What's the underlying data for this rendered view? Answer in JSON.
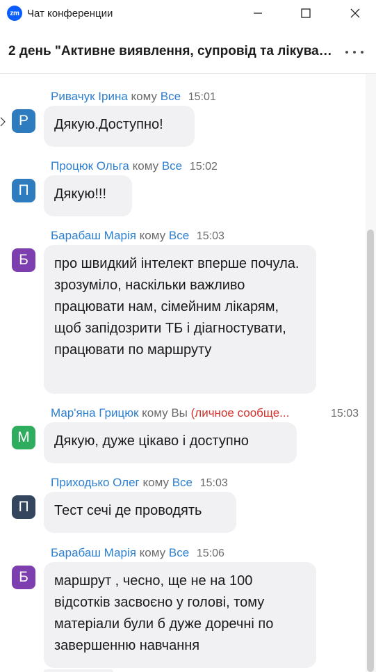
{
  "window": {
    "logo_text": "zm",
    "title": "Чат конференции"
  },
  "header": {
    "title": "2 день \"Активне виявлення, супровід та лікування"
  },
  "messages": [
    {
      "avatar_letter": "Р",
      "avatar_color": "#2e7cc0",
      "sender": "Ривачук Ірина",
      "to_word": "кому",
      "to_target": "Все",
      "private": "",
      "time": "15:01",
      "text": "Дякую.Доступно!"
    },
    {
      "avatar_letter": "П",
      "avatar_color": "#2e7cc0",
      "sender": "Процюк Ольга",
      "to_word": "кому",
      "to_target": "Все",
      "private": "",
      "time": "15:02",
      "text": "Дякую!!!"
    },
    {
      "avatar_letter": "Б",
      "avatar_color": "#7d3fb0",
      "sender": "Барабаш Марія",
      "to_word": "кому",
      "to_target": "Все",
      "private": "",
      "time": "15:03",
      "text": "про швидкий  інтелект вперше почула. зрозуміло, наскільки важливо працювати нам, сімейним лікарям, щоб запідозрити ТБ і діагностувати, працювати по маршруту"
    },
    {
      "avatar_letter": "М",
      "avatar_color": "#2ead5e",
      "sender": "Мар'яна Грицюк",
      "to_word": "кому Вы",
      "to_target": "",
      "private": "(личное сообще...",
      "time": "15:03",
      "text": "Дякую,  дуже цікаво і доступно"
    },
    {
      "avatar_letter": "П",
      "avatar_color": "#33465e",
      "sender": "Приходько Олег",
      "to_word": "кому",
      "to_target": "Все",
      "private": "",
      "time": "15:03",
      "text": "Тест сечі де проводять"
    },
    {
      "avatar_letter": "Б",
      "avatar_color": "#7d3fb0",
      "sender": "Барабаш Марія",
      "to_word": "кому",
      "to_target": "Все",
      "private": "",
      "time": "15:06",
      "text": "маршрут , чесно, ще не на 100 відсотків засвоєно у голові, тому матеріали були б дуже доречні по завершенню навчання"
    }
  ]
}
